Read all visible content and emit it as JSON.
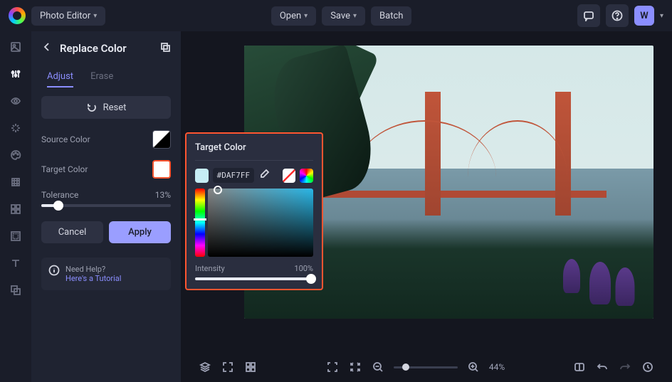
{
  "header": {
    "app": "Photo Editor",
    "open": "Open",
    "save": "Save",
    "batch": "Batch",
    "avatar": "W"
  },
  "panel": {
    "title": "Replace Color",
    "tabs": {
      "adjust": "Adjust",
      "erase": "Erase"
    },
    "reset": "Reset",
    "source": "Source Color",
    "target": "Target Color",
    "tolerance": "Tolerance",
    "tolerance_val": "13%",
    "cancel": "Cancel",
    "apply": "Apply"
  },
  "help": {
    "q": "Need Help?",
    "link": "Here's a Tutorial"
  },
  "popup": {
    "title": "Target Color",
    "hex": "#DAF7FF",
    "intensity": "Intensity",
    "intensity_val": "100%"
  },
  "zoom": {
    "pct": "44%"
  },
  "colors": {
    "target_swatch": "#c6edf5",
    "no_color": "linear-gradient(135deg,#fff 45%,#ff3030 45%,#ff3030 55%,#fff 55%)",
    "rainbow": "conic-gradient(red,#ff0,#0f0,#0ff,#00f,#f0f,red)"
  }
}
